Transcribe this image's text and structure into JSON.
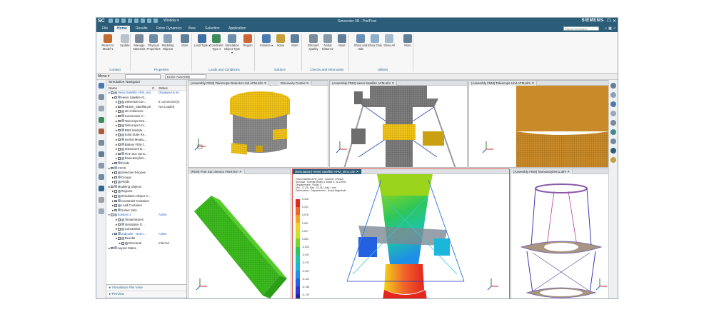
{
  "titlebar": {
    "logo": "SC",
    "window_label": "Window ▾",
    "title": "Simcenter 3D - Pre/Post",
    "brand": "SIEMENS",
    "min": "–",
    "max": "❐",
    "close": "✕"
  },
  "menu_tabs": [
    "File",
    "Home",
    "Results",
    "Rotor Dynamics",
    "View",
    "Selection",
    "Application"
  ],
  "active_tab": "Home",
  "search_placeholder": "Find a Command",
  "ribbon": {
    "buttons": [
      {
        "label": "Return to Model ▾",
        "color": "#c66b2f"
      },
      {
        "label": "Update",
        "color": "#b9c3cc"
      },
      {
        "label": "Manage Materials",
        "color": "#7a8a99"
      },
      {
        "label": "Physical Properties",
        "color": "#6c8da5"
      },
      {
        "label": "Modeling Objects",
        "color": "#8fa4b8"
      },
      {
        "label": "More",
        "color": "#5f7f99"
      },
      {
        "label": "Load Type ▾",
        "color": "#3f6ea3"
      },
      {
        "label": "Constraint Type ▾",
        "color": "#3d8a5a"
      },
      {
        "label": "Simulation Object Type ▾",
        "color": "#6d8faa"
      },
      {
        "label": "Region",
        "color": "#d06533"
      },
      {
        "label": "Solution ▾",
        "color": "#4a7bb0"
      },
      {
        "label": "Solve",
        "color": "#c2a13a"
      },
      {
        "label": "More",
        "color": "#5f7f99"
      },
      {
        "label": "Element Quality",
        "color": "#7b8c9c"
      },
      {
        "label": "Nodal Distance",
        "color": "#8a9aa9"
      },
      {
        "label": "More",
        "color": "#5f7f99"
      },
      {
        "label": "Show and Hide",
        "color": "#6a90b3"
      },
      {
        "label": "Show Only",
        "color": "#8fb0cc"
      },
      {
        "label": "Show All",
        "color": "#a3bad0"
      },
      {
        "label": "More",
        "color": "#5f7f99"
      }
    ],
    "groups": [
      "Context",
      "Properties",
      "Loads and Conditions",
      "Solution",
      "Checks and Information",
      "Utilities"
    ]
  },
  "filterbar": {
    "menu_label": "Menu ▾",
    "filter_value": "",
    "scope_value": "Entire Assembly"
  },
  "navigator": {
    "title": "Simulation Navigator",
    "col_name": "Name",
    "col_c": "C.",
    "col_status": "Status",
    "rows": [
      {
        "indent": 0,
        "name": "Hessi Satellite AFM_sim...",
        "status": "Displayed & W...",
        "blue": true
      },
      {
        "indent": 1,
        "name": "Hessi Satellite Af...",
        "status": "",
        "blue": false
      },
      {
        "indent": 2,
        "name": "Universal Con...",
        "status": "5 connection(s)",
        "blue": false
      },
      {
        "indent": 2,
        "name": "HESSI_Satellite.prt",
        "status": "Not Loaded",
        "blue": false
      },
      {
        "indent": 2,
        "name": "1D Collectors",
        "status": "",
        "blue": false
      },
      {
        "indent": 2,
        "name": "Connection C...",
        "status": "",
        "blue": false
      },
      {
        "indent": 2,
        "name": "Telescope Det...",
        "status": "",
        "blue": false
      },
      {
        "indent": 2,
        "name": "Telescope Uni...",
        "status": "",
        "blue": false
      },
      {
        "indent": 2,
        "name": "EMS Module ...",
        "status": "",
        "blue": false
      },
      {
        "indent": 2,
        "name": "Solid State Re...",
        "status": "",
        "blue": false
      },
      {
        "indent": 2,
        "name": "Inertial Measu...",
        "status": "",
        "blue": false
      },
      {
        "indent": 2,
        "name": "Battery FEM.f...",
        "status": "",
        "blue": false
      },
      {
        "indent": 2,
        "name": "Instrument D...",
        "status": "",
        "blue": false
      },
      {
        "indent": 2,
        "name": "Fine Sun Sens...",
        "status": "",
        "blue": false
      },
      {
        "indent": 2,
        "name": "frameassyfem...",
        "status": "",
        "blue": false
      },
      {
        "indent": 1,
        "name": "Fields",
        "status": "",
        "blue": false
      },
      {
        "indent": 0,
        "name": "CSYS",
        "status": "",
        "blue": false
      },
      {
        "indent": 1,
        "name": "Selection Recipes",
        "status": "",
        "blue": false
      },
      {
        "indent": 1,
        "name": "Groups",
        "status": "",
        "blue": false
      },
      {
        "indent": 1,
        "name": "Fields",
        "status": "",
        "blue": false
      },
      {
        "indent": 0,
        "name": "Modeling Objects",
        "status": "",
        "blue": false
      },
      {
        "indent": 1,
        "name": "Regions",
        "status": "",
        "blue": false
      },
      {
        "indent": 1,
        "name": "Simulation Object C...",
        "status": "",
        "blue": false
      },
      {
        "indent": 1,
        "name": "Constraint Container",
        "status": "",
        "blue": false
      },
      {
        "indent": 1,
        "name": "Load Container",
        "status": "",
        "blue": false
      },
      {
        "indent": 1,
        "name": "Solver Sets",
        "status": "",
        "blue": false
      },
      {
        "indent": 0,
        "name": "Solution 1",
        "status": "Active",
        "blue": true
      },
      {
        "indent": 2,
        "name": "Temperatures",
        "status": "",
        "blue": false
      },
      {
        "indent": 2,
        "name": "Simulation O...",
        "status": "",
        "blue": false
      },
      {
        "indent": 2,
        "name": "Constraints",
        "status": "",
        "blue": false
      },
      {
        "indent": 1,
        "name": "Subcase - Norm...",
        "status": "Active",
        "blue": true
      },
      {
        "indent": 2,
        "name": "Results",
        "status": "",
        "blue": false
      },
      {
        "indent": 3,
        "name": "Structural",
        "status": "Inferred",
        "blue": false
      },
      {
        "indent": 0,
        "name": "Layout States",
        "status": "",
        "blue": false
      }
    ],
    "footer_1": "Simulation File View",
    "footer_2": "Preview"
  },
  "viewports": {
    "v1_tab": "(Assembly FEM) Telescope Detector Unit AFM.afm",
    "v1_tab2": "Discovery Center",
    "v2_tab": "(Assembly FEM) Hessi Satellite AFM.afm",
    "v3_tab": "(Assembly FEM) Telescope Unit AFM.afm",
    "v4_tab": "(FEM) Fine Sun Sensor FEM.fem",
    "v5_tab": "(Simulation) Hessi Satellite AFM_sim1.sim",
    "v6_tab": "(Assembly FEM) frameassyfem1.afm"
  },
  "result_info": "Hessi Satellite AFM_sim1 : Solution 1 Result\nSubcase - Normal Modes 1, Mode 3, 16.229Hz\nDisplacement - Nodal, X\nMin : -0.170, Max : 0.126, Units = mm\nDeformation : Displacement - Nodal Magnitude",
  "legend": {
    "values": [
      "0.126",
      "0.101",
      "0.076",
      "0.051",
      "0.027",
      "0.002",
      "-0.023",
      "-0.047",
      "-0.072",
      "-0.097",
      "-0.121",
      "-0.146",
      "-0.170"
    ],
    "unit": "(mm)",
    "colors": [
      "#e4261f",
      "#f0642a",
      "#f5a51d",
      "#f2d21a",
      "#c9e41c",
      "#7ad52a",
      "#2dc65b",
      "#1fc3a7",
      "#1bb6d9",
      "#1f8ee6",
      "#2361e0",
      "#2e38cf",
      "#2b20a6"
    ]
  },
  "colors": {
    "accent": "#2b5d79",
    "active_border": "#d9534f"
  }
}
